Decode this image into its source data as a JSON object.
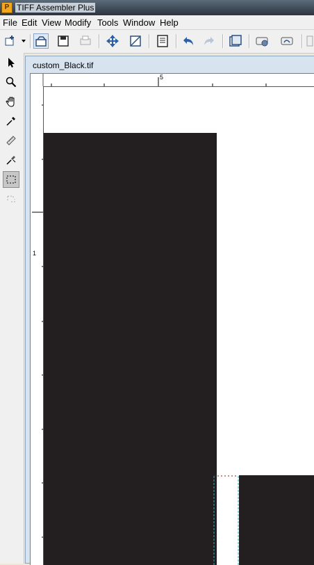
{
  "app": {
    "title": "TIFF Assembler Plus"
  },
  "menu": [
    "File",
    "Edit",
    "View",
    "Modify",
    "Tools",
    "Window",
    "Help"
  ],
  "document": {
    "title": "custom_Black.tif"
  },
  "rulers": {
    "h_label": "5",
    "v_label": "1"
  },
  "colors": {
    "fill": "#231f20",
    "guide": "#26b3c9",
    "selection_top": "#8a1a1a"
  },
  "toolbar_icons": [
    "new-icon",
    "dropdown-icon",
    "open-icon",
    "save-icon",
    "print-icon",
    "move-icon",
    "crop-icon",
    "page-icon",
    "undo-icon",
    "redo-icon",
    "layer-icon",
    "scan-icon",
    "export-icon"
  ],
  "tool_icons": [
    "pointer-icon",
    "zoom-icon",
    "hand-icon",
    "eyedropper-icon",
    "ruler-icon",
    "brush-icon",
    "marquee-icon",
    "lasso-icon"
  ]
}
